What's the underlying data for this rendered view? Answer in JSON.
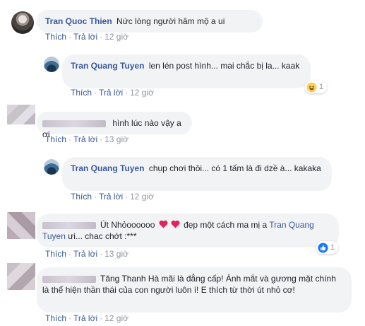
{
  "actions": {
    "like": "Thích",
    "reply": "Trả lời",
    "sep": "·"
  },
  "comments": [
    {
      "author": "Tran Quoc Thien",
      "text": "Nức lòng người hâm mộ a ui",
      "time": "12 giờ"
    },
    {
      "author": "Tran Quang Tuyen",
      "text": "len lén post hình... mai chắc bị la... kaak",
      "time": "12 giờ",
      "reaction_count": "1",
      "reaction_icon": "haha-icon"
    },
    {
      "author": "",
      "text": "hình lúc nào vậy a ơi",
      "time": "13 giờ"
    },
    {
      "author": "Tran Quang Tuyen",
      "text": "chụp chơi thôi... có 1 tấm là đi dzề à... kakaka",
      "time": "12 giờ"
    },
    {
      "author_suffix": "Út Nhỏoooooo",
      "text_after_hearts": "đẹp một cách ma mị a",
      "mention": "Tran Quang Tuyen",
      "text_end": "ưi... chac chớt :***",
      "time": "13 giờ",
      "reaction_count": "1",
      "reaction_icon": "like-icon"
    },
    {
      "text": "Tăng Thanh Hà mãi là đẳng cấp! Ánh mắt và gương mặt chính là thể hiện thần thái của con người luôn í! E thích từ thời út nhỏ cơ!",
      "time": "12 giờ"
    }
  ],
  "colors": {
    "link": "#385898",
    "bubble": "#f2f3f5",
    "meta": "#90949c",
    "heart": "#e0245e"
  }
}
